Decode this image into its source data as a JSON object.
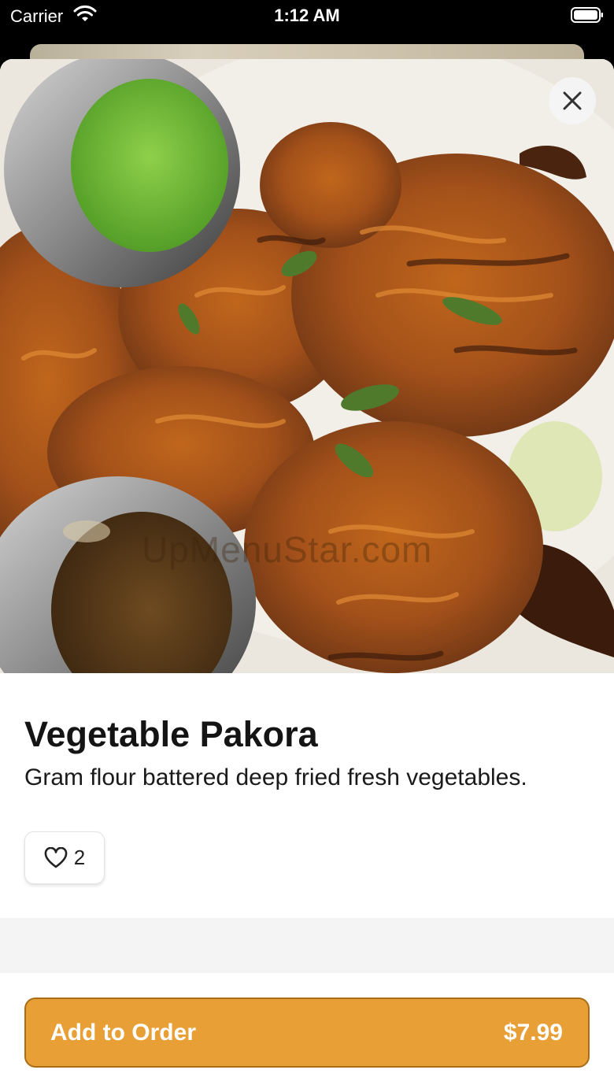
{
  "status_bar": {
    "carrier": "Carrier",
    "time": "1:12 AM",
    "wifi_icon": "wifi-icon",
    "battery_icon": "battery-icon"
  },
  "item": {
    "image_alt": "vegetable-pakora-photo",
    "watermark": "UpMenuStar.com",
    "title": "Vegetable Pakora",
    "description": "Gram flour battered deep fried fresh vegetables.",
    "like_count": "2"
  },
  "actions": {
    "close_icon": "close-icon",
    "like_icon": "heart-icon",
    "add_to_order_label": "Add to Order",
    "price": "$7.99"
  },
  "colors": {
    "accent": "#e79f36",
    "accent_border": "#a96d17",
    "text": "#141414"
  }
}
